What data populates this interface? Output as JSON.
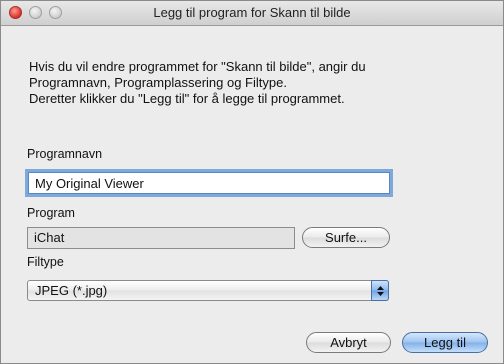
{
  "window": {
    "title": "Legg til program for Skann til bilde"
  },
  "description": {
    "lines": [
      "Hvis du vil endre programmet for \"Skann til bilde\", angir du",
      "Programnavn, Programplassering og Filtype.",
      "Deretter klikker du \"Legg til\" for å legge til programmet."
    ]
  },
  "form": {
    "program_name_label": "Programnavn",
    "program_name_value": "My Original Viewer",
    "program_label": "Program",
    "program_value": "iChat",
    "browse_label": "Surfe...",
    "filetype_label": "Filtype",
    "filetype_value": "JPEG (*.jpg)"
  },
  "buttons": {
    "cancel_label": "Avbryt",
    "add_label": "Legg til"
  },
  "icons": {
    "close": "close-window-icon",
    "minimize": "minimize-window-icon",
    "zoom": "zoom-window-icon",
    "stepper": "up-down-arrows-icon"
  },
  "colors": {
    "close_button": "#d8322a",
    "focus_ring": "#7fa8dd",
    "default_button": "#82b0ea"
  }
}
